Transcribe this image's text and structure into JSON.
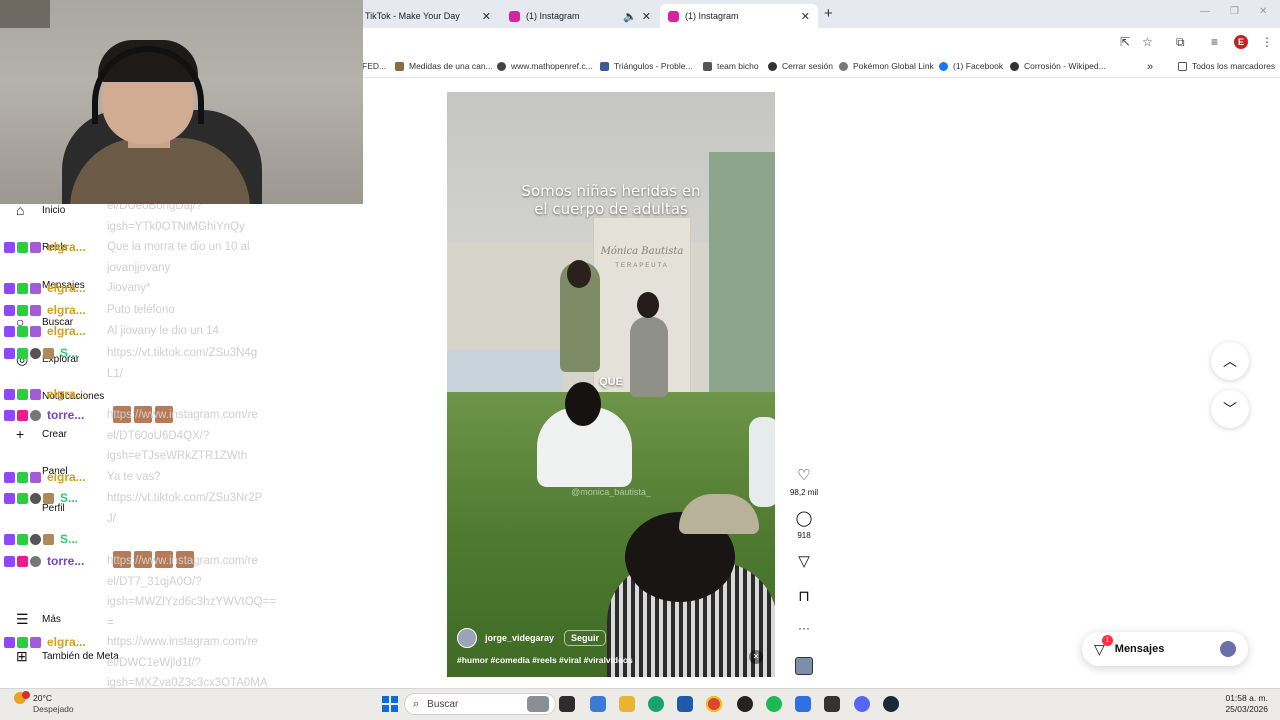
{
  "browser": {
    "tabs": [
      {
        "label": "TikTok - Make Your Day",
        "active": false
      },
      {
        "label": "(1) Instagram",
        "active": false
      },
      {
        "label": "(1) Instagram",
        "active": true
      }
    ],
    "new_tab_symbol": "+",
    "profile_initial": "E",
    "bookmarks": [
      {
        "label": "FED..."
      },
      {
        "label": "Medidas de una can..."
      },
      {
        "label": "www.mathopenref.c..."
      },
      {
        "label": "Triángulos - Proble..."
      },
      {
        "label": "team bicho"
      },
      {
        "label": "Cerrar sesión"
      },
      {
        "label": "Pokémon Global Link"
      },
      {
        "label": "(1) Facebook"
      },
      {
        "label": "Corrosión - Wikiped..."
      },
      {
        "label": "Todos los marcadores"
      }
    ],
    "bookmarks_more": "»"
  },
  "ig_nav": {
    "inicio": "Inicio",
    "reels": "Reels",
    "mensajes": "Mensajes",
    "mensajes_badge": "1",
    "buscar": "Buscar",
    "explorar": "Explorar",
    "notificaciones": "Notificaciones",
    "crear": "Crear",
    "panel": "Panel",
    "perfil": "Perfil",
    "mas": "Más",
    "tambien_de_meta": "También de Meta"
  },
  "chat": {
    "colors": {
      "elgra": "#d4a017",
      "torre": "#7b3fd0",
      "s": "#2ecc71"
    },
    "rows": [
      {
        "name": "elgra...",
        "color_key": "elgra",
        "msg": "Que la morra te dio un 10 al\njovanjjovany"
      },
      {
        "name": "elgra...",
        "color_key": "elgra",
        "msg": "Jiovany*"
      },
      {
        "name": "elgra...",
        "color_key": "elgra",
        "msg": "Puto teléfono"
      },
      {
        "name": "elgra...",
        "color_key": "elgra",
        "msg": "Al jiovany le dio un 14"
      },
      {
        "name": "S...",
        "color_key": "s",
        "msg": "https://vt.tiktok.com/ZSu3N4g\nL1/"
      },
      {
        "name": "elgra...",
        "color_key": "elgra",
        "msg": ""
      },
      {
        "name": "torre...",
        "color_key": "torre",
        "msg": "https://www.instagram.com/re\nel/DT60oU6D4QX/?\nigsh=eTJseWRkZTR1ZWth"
      },
      {
        "name": "elgra...",
        "color_key": "elgra",
        "msg": "Ya te vas?"
      },
      {
        "name": "S...",
        "color_key": "s",
        "msg": "https://vt.tiktok.com/ZSu3Nr2P\nJ/"
      },
      {
        "name": "S...",
        "color_key": "s",
        "msg": ""
      },
      {
        "name": "torre...",
        "color_key": "torre",
        "msg": "https://www.instagram.com/re\nel/DT7_31qjA0O/?\nigsh=MWZlYzd6c3hzYWVtOQ==\n="
      },
      {
        "name": "elgra...",
        "color_key": "elgra",
        "msg": "https://www.instagram.com/re\nel/DWC1eWjld1f/?\nigsh=MXZva0Z3c3cx3OTA0MA\n=="
      }
    ],
    "top_fragment": "el/DUeoBongDaj/?\nigsh=YTk0OTNiMGhiYnQy"
  },
  "reel": {
    "caption_line1": "Somos niñas heridas en",
    "caption_line2": "el cuerpo de adultas",
    "overlay_word": "QUE",
    "banner_text": "Mónica Bautista",
    "banner_sub": "TERAPEUTA",
    "watermark": "@monica_bautista_",
    "username": "jorge_videgaray",
    "follow_label": "Seguir",
    "hashtags": "#humor #comedia #reels #viral #viralvideos"
  },
  "actions": {
    "likes": "98,2 mil",
    "comments": "918",
    "more": "···"
  },
  "messages_pill": {
    "label": "Mensajes",
    "badge": "1"
  },
  "taskbar": {
    "temperature": "20°C",
    "weather": "Despejado",
    "search_label": "Buscar",
    "time": "01:58 a. m.",
    "date": "25/03/2026"
  }
}
